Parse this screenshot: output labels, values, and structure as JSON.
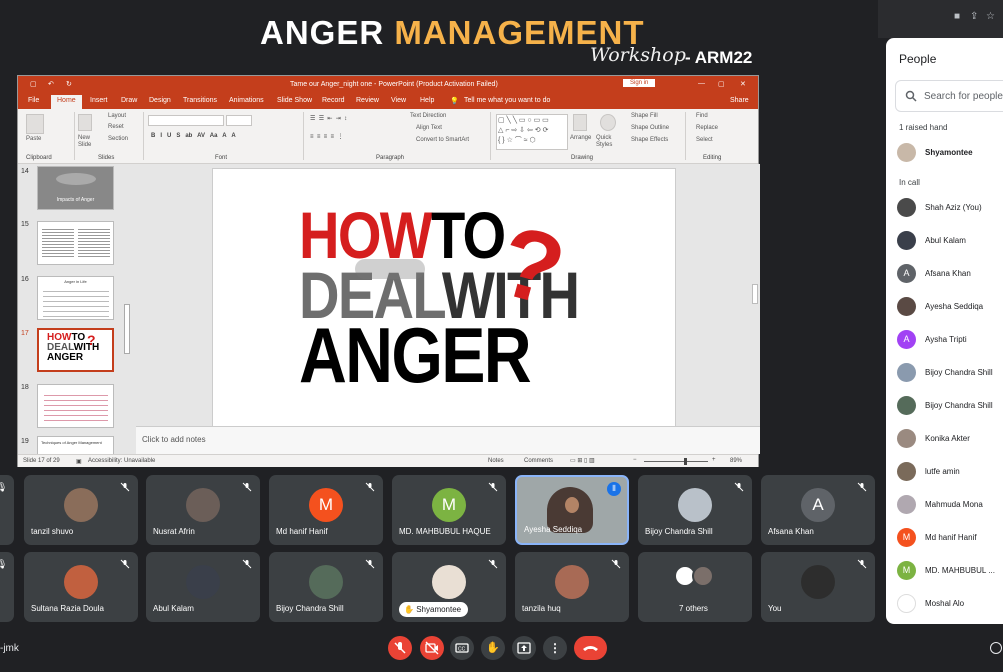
{
  "banner": {
    "title_white": "ANGER",
    "title_gold": "MANAGEMENT",
    "subtitle": "Workshop",
    "code": "- ARM22"
  },
  "ppt": {
    "window_title": "Tame our Anger_night one  -  PowerPoint (Product Activation Failed)",
    "signin": "Sign in",
    "tabs": [
      "File",
      "Home",
      "Insert",
      "Draw",
      "Design",
      "Transitions",
      "Animations",
      "Slide Show",
      "Record",
      "Review",
      "View",
      "Help"
    ],
    "tell_me": "Tell me what you want to do",
    "share": "Share",
    "groups": [
      "Clipboard",
      "Slides",
      "Font",
      "Paragraph",
      "Drawing",
      "Editing"
    ],
    "ribbon_labels": {
      "paste": "Paste",
      "new_slide": "New Slide",
      "layout": "Layout",
      "reset": "Reset",
      "section": "Section",
      "text_direction": "Text Direction",
      "align_text": "Align Text",
      "smartart": "Convert to SmartArt",
      "arrange": "Arrange",
      "quick_styles": "Quick Styles",
      "shape_fill": "Shape Fill",
      "shape_outline": "Shape Outline",
      "shape_effects": "Shape Effects",
      "find": "Find",
      "replace": "Replace",
      "select": "Select"
    },
    "thumb_numbers": [
      "14",
      "15",
      "16",
      "17",
      "18",
      "19"
    ],
    "thumb14_caption": "Impacts of Anger",
    "thumb16_caption": "Anger in Life",
    "thumb19_caption": "Techniques of Anger Management",
    "slide": {
      "line1_red": "HOW",
      "line1_black": "TO",
      "line2_grey": "DEAL",
      "line2_black": "WITH",
      "line3": "ANGER",
      "qmark": "?"
    },
    "notes_placeholder": "Click to add notes",
    "status": {
      "slide": "Slide 17 of 29",
      "accessibility": "Accessibility: Unavailable",
      "notes": "Notes",
      "comments": "Comments",
      "zoom": "89%"
    }
  },
  "tiles": [
    {
      "name": "tanzil shuvo",
      "avatar": "photo"
    },
    {
      "name": "Nusrat Afrin",
      "avatar": "photo"
    },
    {
      "name": "Md hanif Hanif",
      "avatar": "letter",
      "letter": "M",
      "color": "#f4511e"
    },
    {
      "name": "MD. MAHBUBUL HAQUE",
      "avatar": "letter",
      "letter": "M",
      "color": "#7cb342"
    },
    {
      "name": "Ayesha Seddiqa",
      "avatar": "video"
    },
    {
      "name": "Bijoy Chandra Shill",
      "avatar": "photo"
    },
    {
      "name": "Afsana Khan",
      "avatar": "letter",
      "letter": "A",
      "color": "#5f6368"
    },
    {
      "name": "Sultana Razia Doula",
      "avatar": "photo"
    },
    {
      "name": "Abul Kalam",
      "avatar": "photo"
    },
    {
      "name": "Bijoy Chandra Shill",
      "avatar": "photo"
    },
    {
      "name": "Shyamontee",
      "avatar": "photo",
      "raised": true
    },
    {
      "name": "tanzila huq",
      "avatar": "photo"
    },
    {
      "name": "7 others",
      "avatar": "group"
    },
    {
      "name": "You",
      "avatar": "photo"
    }
  ],
  "people": {
    "title": "People",
    "search_placeholder": "Search for people",
    "raised_heading": "1 raised hand",
    "raised": [
      {
        "name": "Shyamontee"
      }
    ],
    "incall_heading": "In call",
    "incall": [
      {
        "name": "Shah Aziz (You)",
        "type": "photo"
      },
      {
        "name": "Abul Kalam",
        "type": "photo"
      },
      {
        "name": "Afsana Khan",
        "type": "letter",
        "letter": "A",
        "color": "#5f6368"
      },
      {
        "name": "Ayesha Seddiqa",
        "type": "photo"
      },
      {
        "name": "Aysha Tripti",
        "type": "letter",
        "letter": "A",
        "color": "#a142f4"
      },
      {
        "name": "Bijoy Chandra Shill",
        "type": "photo"
      },
      {
        "name": "Bijoy Chandra Shill",
        "type": "photo"
      },
      {
        "name": "Konika Akter",
        "type": "photo"
      },
      {
        "name": "lutfe amin",
        "type": "photo"
      },
      {
        "name": "Mahmuda Mona",
        "type": "photo"
      },
      {
        "name": "Md hanif Hanif",
        "type": "letter",
        "letter": "M",
        "color": "#f4511e"
      },
      {
        "name": "MD. MAHBUBUL ...",
        "type": "letter",
        "letter": "M",
        "color": "#7cb342"
      },
      {
        "name": "Moshal Alo",
        "type": "logo"
      }
    ]
  },
  "meeting_code": "-jmk",
  "colors": {
    "bg": "#202124",
    "tile": "#3c4043",
    "accent_red": "#ea4335",
    "ppt_red": "#c43e1c",
    "gold": "#f6b24a"
  }
}
